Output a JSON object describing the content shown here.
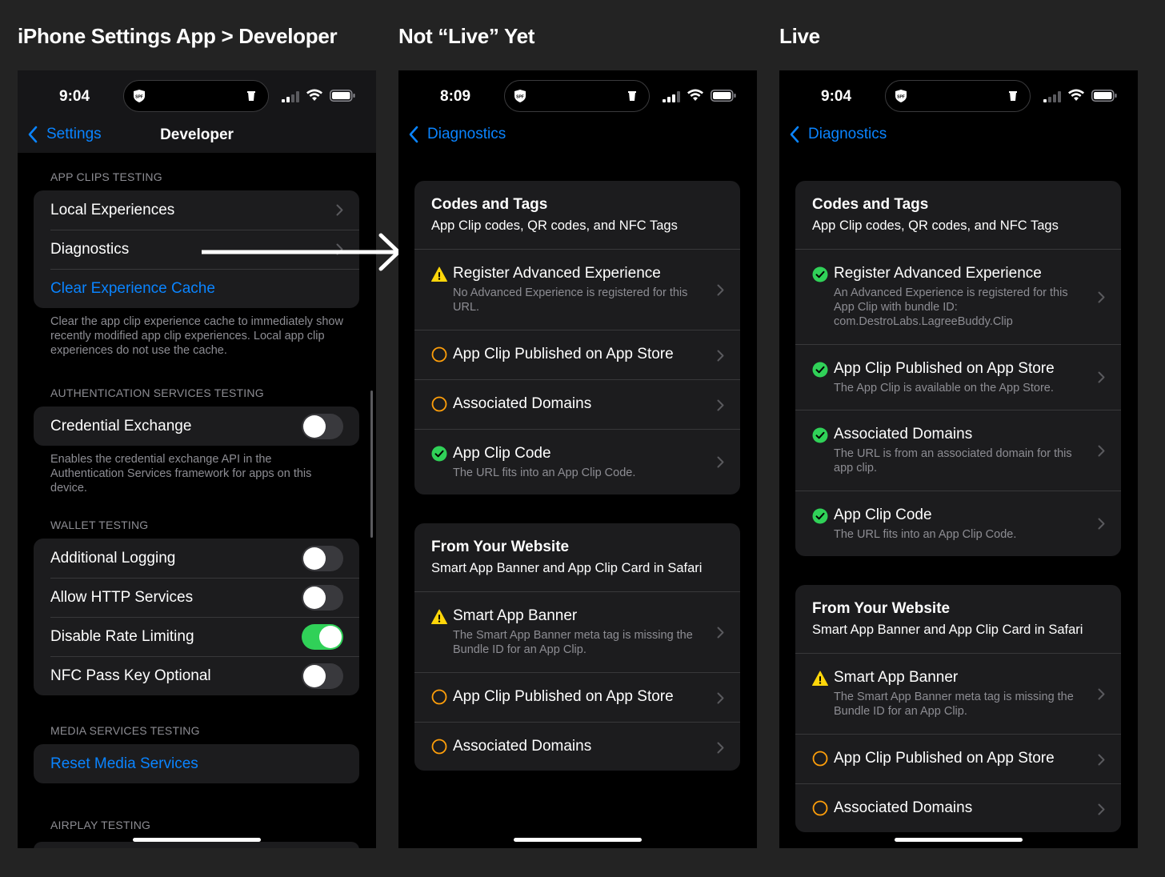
{
  "captions": {
    "developer": "iPhone Settings App > Developer",
    "not_live": "Not “Live” Yet",
    "live": "Live"
  },
  "developer_screen": {
    "time": "9:04",
    "back_label": "Settings",
    "title": "Developer",
    "sections": {
      "app_clips": {
        "header": "APP CLIPS TESTING",
        "rows": [
          "Local Experiences",
          "Diagnostics",
          "Clear Experience Cache"
        ],
        "footer": "Clear the app clip experience cache to immediately show recently modified app clip experiences. Local app clip experiences do not use the cache."
      },
      "auth": {
        "header": "AUTHENTICATION SERVICES TESTING",
        "rows": [
          "Credential Exchange"
        ],
        "footer": "Enables the credential exchange API in the Authentication Services framework for apps on this device."
      },
      "wallet": {
        "header": "WALLET TESTING",
        "rows": [
          "Additional Logging",
          "Allow HTTP Services",
          "Disable Rate Limiting",
          "NFC Pass Key Optional"
        ],
        "toggles": [
          false,
          false,
          true,
          false
        ]
      },
      "media": {
        "header": "MEDIA SERVICES TESTING",
        "rows": [
          "Reset Media Services"
        ]
      },
      "airplay": {
        "header": "AIRPLAY TESTING"
      }
    }
  },
  "not_live_screen": {
    "time": "8:09",
    "back_label": "Diagnostics",
    "codes_card": {
      "title": "Codes and Tags",
      "subtitle": "App Clip codes, QR codes, and NFC Tags",
      "items": [
        {
          "title": "Register Advanced Experience",
          "detail": "No Advanced Experience is registered for this URL.",
          "status": "warning"
        },
        {
          "title": "App Clip Published on App Store",
          "detail": "",
          "status": "pending"
        },
        {
          "title": "Associated Domains",
          "detail": "",
          "status": "pending"
        },
        {
          "title": "App Clip Code",
          "detail": "The URL fits into an App Clip Code.",
          "status": "ok"
        }
      ]
    },
    "website_card": {
      "title": "From Your Website",
      "subtitle": "Smart App Banner and App Clip Card in Safari",
      "items": [
        {
          "title": "Smart App Banner",
          "detail": "The Smart App Banner meta tag is missing the Bundle ID for an App Clip.",
          "status": "warning"
        },
        {
          "title": "App Clip Published on App Store",
          "detail": "",
          "status": "pending"
        },
        {
          "title": "Associated Domains",
          "detail": "",
          "status": "pending"
        }
      ]
    }
  },
  "live_screen": {
    "time": "9:04",
    "back_label": "Diagnostics",
    "codes_card": {
      "title": "Codes and Tags",
      "subtitle": "App Clip codes, QR codes, and NFC Tags",
      "items": [
        {
          "title": "Register Advanced Experience",
          "detail": "An Advanced Experience is registered for this App Clip with bundle ID: com.DestroLabs.LagreeBuddy.Clip",
          "status": "ok"
        },
        {
          "title": "App Clip Published on App Store",
          "detail": "The App Clip is available on the App Store.",
          "status": "ok"
        },
        {
          "title": "Associated Domains",
          "detail": "The URL is from an associated domain for this app clip.",
          "status": "ok"
        },
        {
          "title": "App Clip Code",
          "detail": "The URL fits into an App Clip Code.",
          "status": "ok"
        }
      ]
    },
    "website_card": {
      "title": "From Your Website",
      "subtitle": "Smart App Banner and App Clip Card in Safari",
      "items": [
        {
          "title": "Smart App Banner",
          "detail": "The Smart App Banner meta tag is missing the Bundle ID for an App Clip.",
          "status": "warning"
        },
        {
          "title": "App Clip Published on App Store",
          "detail": "",
          "status": "pending"
        },
        {
          "title": "Associated Domains",
          "detail": "",
          "status": "pending"
        }
      ]
    }
  },
  "colors": {
    "accent_blue": "#0a84ff",
    "ok_green": "#30d158",
    "warning_yellow": "#ffd60a",
    "pending_orange": "#ff9f0a"
  }
}
